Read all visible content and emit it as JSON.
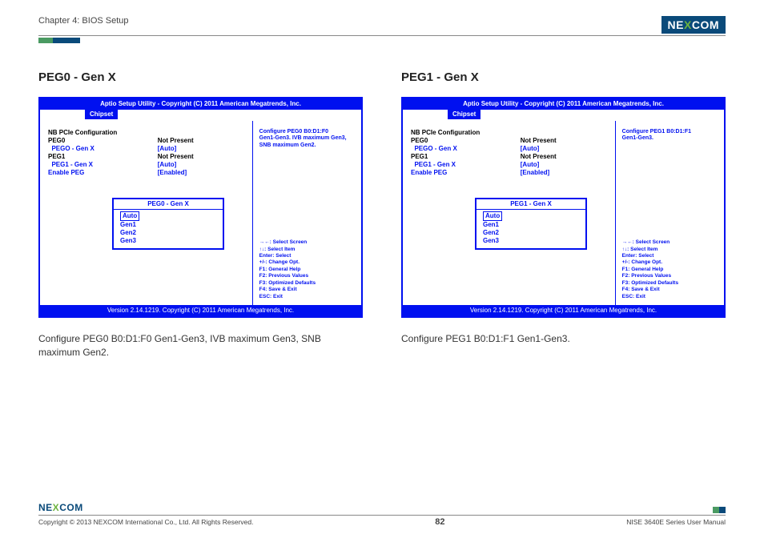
{
  "header": {
    "chapter": "Chapter 4: BIOS Setup",
    "logo_pre": "NE",
    "logo_x": "X",
    "logo_post": "COM"
  },
  "left": {
    "heading": "PEG0 - Gen X",
    "bios": {
      "title": "Aptio Setup Utility - Copyright (C) 2011 American Megatrends, Inc.",
      "tab": "Chipset",
      "section": "NB PCIe Configuration",
      "rows": [
        {
          "label": "PEG0",
          "value": "Not Present",
          "labelBlue": false,
          "valueBlue": false,
          "bold": true
        },
        {
          "label": "  PEGO - Gen X",
          "value": "[Auto]",
          "labelBlue": true,
          "valueBlue": true,
          "bold": true
        },
        {
          "label": "PEG1",
          "value": "Not Present",
          "labelBlue": false,
          "valueBlue": false,
          "bold": true
        },
        {
          "label": "  PEG1 - Gen X",
          "value": "[Auto]",
          "labelBlue": true,
          "valueBlue": true,
          "bold": true
        },
        {
          "label": "",
          "value": ""
        },
        {
          "label": "Enable PEG",
          "value": "[Enabled]",
          "labelBlue": true,
          "valueBlue": true,
          "bold": true
        }
      ],
      "popup_title": "PEG0 - Gen X",
      "popup_items": [
        "Auto",
        "Gen1",
        "Gen2",
        "Gen3"
      ],
      "help_lines": [
        "Configure PEG0 B0:D1:F0",
        "Gen1-Gen3. IVB maximum Gen3,",
        "SNB maximum Gen2."
      ],
      "keys": [
        "→←: Select Screen",
        "↑↓: Select Item",
        "Enter: Select",
        "+/-: Change Opt.",
        "F1: General Help",
        "F2: Previous Values",
        "F3: Optimized Defaults",
        "F4: Save & Exit",
        "ESC: Exit"
      ],
      "footer": "Version 2.14.1219. Copyright (C) 2011 American Megatrends, Inc."
    },
    "desc": "Configure PEG0 B0:D1:F0 Gen1-Gen3, IVB maximum Gen3, SNB maximum Gen2."
  },
  "right": {
    "heading": "PEG1 - Gen X",
    "bios": {
      "title": "Aptio Setup Utility - Copyright (C) 2011 American Megatrends, Inc.",
      "tab": "Chipset",
      "section": "NB PCIe Configuration",
      "rows": [
        {
          "label": "PEG0",
          "value": "Not Present",
          "labelBlue": false,
          "valueBlue": false,
          "bold": true
        },
        {
          "label": "  PEGO - Gen X",
          "value": "[Auto]",
          "labelBlue": true,
          "valueBlue": true,
          "bold": true
        },
        {
          "label": "PEG1",
          "value": "Not Present",
          "labelBlue": false,
          "valueBlue": false,
          "bold": true
        },
        {
          "label": "  PEG1 - Gen X",
          "value": "[Auto]",
          "labelBlue": true,
          "valueBlue": true,
          "bold": true
        },
        {
          "label": "",
          "value": ""
        },
        {
          "label": "Enable PEG",
          "value": "[Enabled]",
          "labelBlue": true,
          "valueBlue": true,
          "bold": true
        }
      ],
      "popup_title": "PEG1 - Gen X",
      "popup_items": [
        "Auto",
        "Gen1",
        "Gen2",
        "Gen3"
      ],
      "help_lines": [
        "Configure PEG1 B0:D1:F1",
        "Gen1-Gen3."
      ],
      "keys": [
        "→←: Select Screen",
        "↑↓: Select Item",
        "Enter: Select",
        "+/-: Change Opt.",
        "F1: General Help",
        "F2: Previous Values",
        "F3: Optimized Defaults",
        "F4: Save & Exit",
        "ESC: Exit"
      ],
      "footer": "Version 2.14.1219. Copyright (C) 2011 American Megatrends, Inc."
    },
    "desc": "Configure PEG1 B0:D1:F1 Gen1-Gen3."
  },
  "footer": {
    "copyright": "Copyright © 2013 NEXCOM International Co., Ltd. All Rights Reserved.",
    "page": "82",
    "manual": "NISE 3640E Series User Manual"
  }
}
